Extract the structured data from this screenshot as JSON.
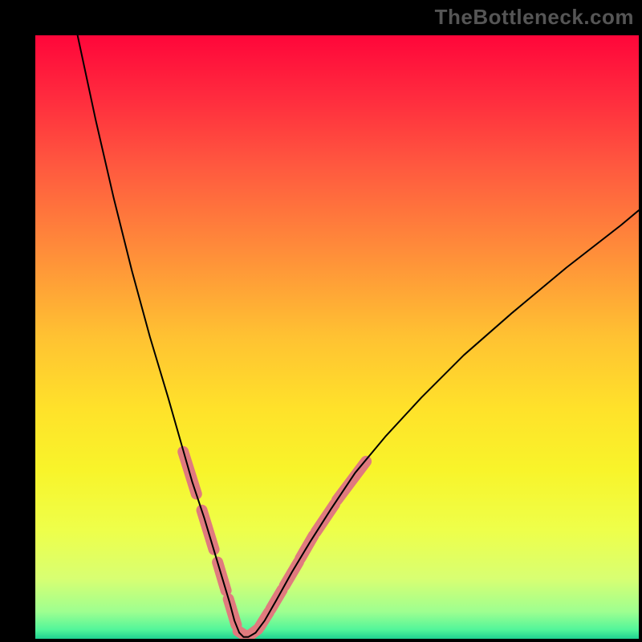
{
  "watermark": "TheBottleneck.com",
  "chart_data": {
    "type": "line",
    "title": "",
    "xlabel": "",
    "ylabel": "",
    "xlim": [
      0,
      100
    ],
    "ylim": [
      0,
      100
    ],
    "grid": false,
    "legend": false,
    "gradient_stops": [
      {
        "pos": 0.0,
        "color": "#ff063a"
      },
      {
        "pos": 0.1,
        "color": "#ff2a3e"
      },
      {
        "pos": 0.22,
        "color": "#ff5a3f"
      },
      {
        "pos": 0.35,
        "color": "#ff8a3a"
      },
      {
        "pos": 0.5,
        "color": "#ffc232"
      },
      {
        "pos": 0.62,
        "color": "#ffe22a"
      },
      {
        "pos": 0.72,
        "color": "#f8f42a"
      },
      {
        "pos": 0.82,
        "color": "#eeff4a"
      },
      {
        "pos": 0.9,
        "color": "#d8ff72"
      },
      {
        "pos": 0.955,
        "color": "#9eff90"
      },
      {
        "pos": 0.985,
        "color": "#52f59a"
      },
      {
        "pos": 1.0,
        "color": "#1fd191"
      }
    ],
    "series": [
      {
        "name": "left-curve",
        "color": "#000000",
        "width": 2,
        "x": [
          7.0,
          10.0,
          13.0,
          16.0,
          19.0,
          22.0,
          24.0,
          26.0,
          28.0,
          29.5,
          31.0,
          32.2,
          33.0,
          33.8
        ],
        "y": [
          100.0,
          86.0,
          73.0,
          61.0,
          50.0,
          40.0,
          33.0,
          26.0,
          20.0,
          15.0,
          10.0,
          6.0,
          3.0,
          1.0
        ]
      },
      {
        "name": "right-curve",
        "color": "#000000",
        "width": 2,
        "x": [
          36.5,
          38.0,
          40.0,
          42.5,
          45.5,
          49.0,
          53.0,
          58.0,
          64.0,
          71.0,
          79.0,
          88.0,
          97.0,
          100.0
        ],
        "y": [
          1.0,
          3.0,
          6.5,
          11.0,
          16.0,
          21.5,
          27.5,
          33.5,
          40.0,
          47.0,
          54.0,
          61.5,
          68.5,
          71.0
        ]
      },
      {
        "name": "valley-floor",
        "color": "#000000",
        "width": 2,
        "x": [
          33.8,
          34.5,
          35.3,
          36.5
        ],
        "y": [
          1.0,
          0.3,
          0.3,
          1.0
        ]
      }
    ],
    "markers": {
      "name": "pink-segments",
      "color": "#e07a7e",
      "width": 14,
      "linecap": "round",
      "segments": [
        {
          "x": [
            24.5,
            26.7
          ],
          "y": [
            31.0,
            24.0
          ]
        },
        {
          "x": [
            27.6,
            29.6
          ],
          "y": [
            21.3,
            14.8
          ]
        },
        {
          "x": [
            30.2,
            31.6
          ],
          "y": [
            12.7,
            8.0
          ]
        },
        {
          "x": [
            32.0,
            33.3
          ],
          "y": [
            6.6,
            2.3
          ]
        },
        {
          "x": [
            33.6,
            35.0
          ],
          "y": [
            1.3,
            0.4
          ]
        },
        {
          "x": [
            35.3,
            36.9
          ],
          "y": [
            0.4,
            1.6
          ]
        },
        {
          "x": [
            37.2,
            38.7
          ],
          "y": [
            2.0,
            4.4
          ]
        },
        {
          "x": [
            39.0,
            40.9
          ],
          "y": [
            4.9,
            8.1
          ]
        },
        {
          "x": [
            41.3,
            43.6
          ],
          "y": [
            8.8,
            12.7
          ]
        },
        {
          "x": [
            43.9,
            46.1
          ],
          "y": [
            13.3,
            17.1
          ]
        },
        {
          "x": [
            46.5,
            49.6
          ],
          "y": [
            17.7,
            22.3
          ]
        },
        {
          "x": [
            50.0,
            54.8
          ],
          "y": [
            23.0,
            29.4
          ]
        }
      ]
    }
  }
}
